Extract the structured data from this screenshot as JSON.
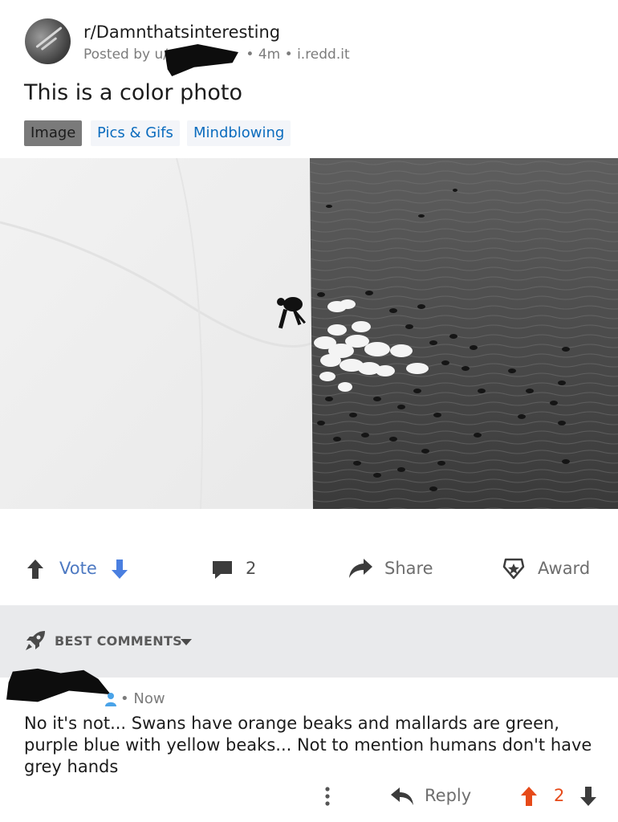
{
  "post": {
    "subreddit": "r/Damnthatsinteresting",
    "posted_by_prefix": "Posted by u/",
    "time": "4m",
    "domain": "i.redd.it",
    "separator": "•",
    "title": "This is a color photo",
    "flairs": [
      "Image",
      "Pics & Gifs",
      "Mindblowing"
    ]
  },
  "actions": {
    "vote_label": "Vote",
    "comment_count": "2",
    "share_label": "Share",
    "award_label": "Award"
  },
  "comments_section": {
    "sort_label": "BEST COMMENTS"
  },
  "comment": {
    "time": "Now",
    "separator": "•",
    "body": "No it's not... Swans have orange beaks and mallards are green, purple blue with yellow beaks... Not to mention humans don't have grey hands",
    "reply_label": "Reply",
    "vote_count": "2"
  },
  "colors": {
    "link_blue": "#0b6cbe",
    "vote_blue": "#4d79c2",
    "upvote_orange": "#e64a19",
    "band_grey": "#e9eaec"
  },
  "icons": [
    "upvote-arrow-icon",
    "downvote-arrow-icon",
    "comment-bubble-icon",
    "share-arrow-icon",
    "award-icon",
    "rocket-icon",
    "caret-down-icon",
    "reply-arrow-icon",
    "more-vertical-icon"
  ]
}
